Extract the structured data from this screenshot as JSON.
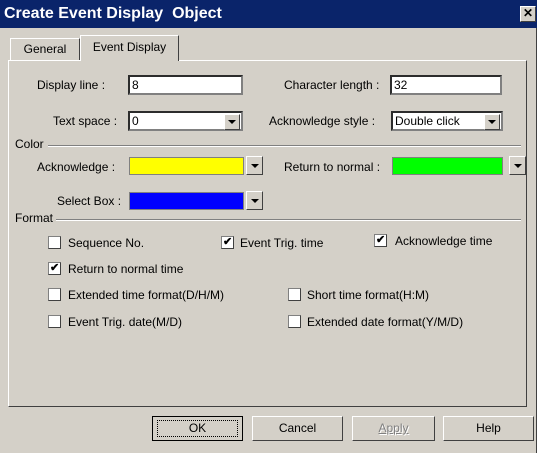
{
  "window": {
    "title": "Create Event Display  Object",
    "close_glyph": "✕"
  },
  "tabs": [
    {
      "label": "General",
      "active": false
    },
    {
      "label": "Event Display",
      "active": true
    }
  ],
  "fields": {
    "display_line": {
      "label": "Display line :",
      "value": "8"
    },
    "character_length": {
      "label": "Character length :",
      "value": "32"
    },
    "text_space": {
      "label": "Text space :",
      "value": "0"
    },
    "acknowledge_style": {
      "label": "Acknowledge style :",
      "value": "Double click"
    }
  },
  "color_group": {
    "title": "Color",
    "acknowledge": {
      "label": "Acknowledge :",
      "color": "#ffff00"
    },
    "return_to_normal": {
      "label": "Return to normal :",
      "color": "#00ff00"
    },
    "select_box": {
      "label": "Select Box :",
      "color": "#0000ff"
    }
  },
  "format_group": {
    "title": "Format",
    "options": {
      "sequence_no": {
        "label": "Sequence No.",
        "checked": false
      },
      "event_trig_time": {
        "label": "Event Trig. time",
        "checked": true
      },
      "acknowledge_time": {
        "label": "Acknowledge time",
        "checked": true
      },
      "return_to_normal_time": {
        "label": "Return to normal time",
        "checked": true
      },
      "extended_time_format": {
        "label": "Extended time format(D/H/M)",
        "checked": false
      },
      "short_time_format": {
        "label": "Short time format(H:M)",
        "checked": false
      },
      "event_trig_date": {
        "label": "Event Trig. date(M/D)",
        "checked": false
      },
      "extended_date_format": {
        "label": "Extended date format(Y/M/D)",
        "checked": false
      }
    }
  },
  "buttons": {
    "ok": "OK",
    "cancel": "Cancel",
    "apply": "Apply",
    "help": "Help"
  },
  "check_glyph": "✔"
}
